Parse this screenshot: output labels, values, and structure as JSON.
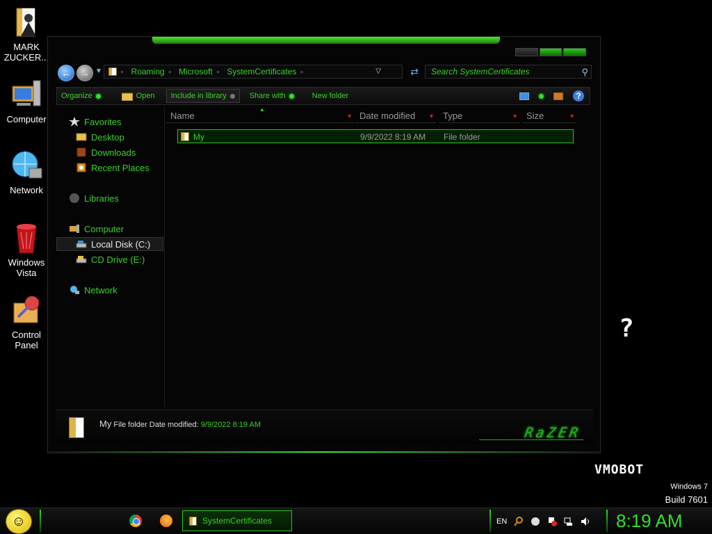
{
  "desktop": {
    "icons": [
      {
        "label": "MARK ZUCKER..."
      },
      {
        "label": "Computer"
      },
      {
        "label": "Network"
      },
      {
        "label": "Windows Vista"
      },
      {
        "label": "Control Panel"
      }
    ],
    "vmobot": "VMOBOT",
    "watermark_line1": "Windows 7",
    "watermark_line2": "Build 7601",
    "pixel_glyph": "?"
  },
  "explorer": {
    "address": {
      "crumbs": [
        "Roaming",
        "Microsoft",
        "SystemCertificates"
      ]
    },
    "search": {
      "placeholder": "Search SystemCertificates"
    },
    "toolbar": {
      "organize": "Organize",
      "open": "Open",
      "include_in_library": "Include in library",
      "share_with": "Share with",
      "new_folder": "New folder"
    },
    "nav": {
      "favorites": "Favorites",
      "desktop": "Desktop",
      "downloads": "Downloads",
      "recent_places": "Recent Places",
      "libraries": "Libraries",
      "computer": "Computer",
      "local_disk": "Local Disk (C:)",
      "cd_drive": "CD Drive (E:)",
      "network": "Network"
    },
    "columns": {
      "name": "Name",
      "date_modified": "Date modified",
      "type": "Type",
      "size": "Size"
    },
    "files": [
      {
        "name": "My",
        "date_modified": "9/9/2022 8:19 AM",
        "type": "File folder",
        "size": ""
      }
    ],
    "details": {
      "name": "My",
      "type": "File folder",
      "date_label": "Date modified:",
      "date_value": "9/9/2022 8:19 AM",
      "logo": "RaZER"
    }
  },
  "taskbar": {
    "task_label": "SystemCertificates",
    "language": "EN",
    "clock": "8:19 AM"
  },
  "colors": {
    "accent": "#39d12a",
    "background": "#000000"
  }
}
